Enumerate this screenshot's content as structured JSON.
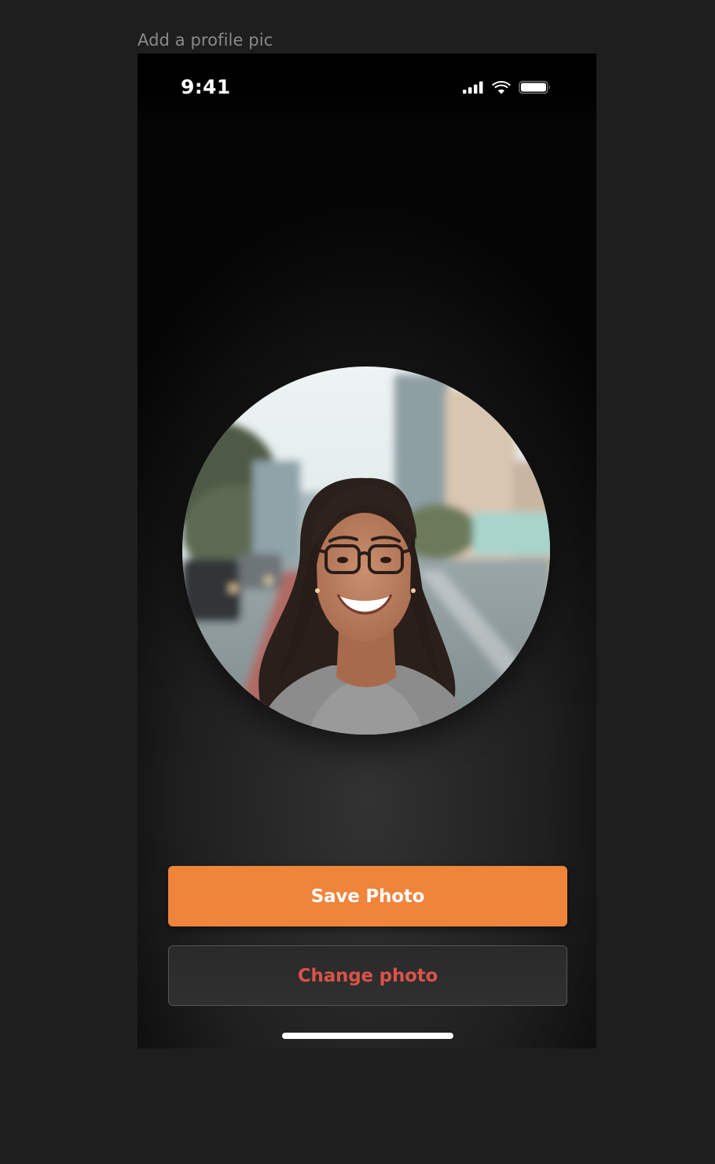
{
  "frame": {
    "label": "Add a profile pic"
  },
  "status_bar": {
    "time": "9:41",
    "icons": [
      "cellular-signal-icon",
      "wifi-icon",
      "battery-icon"
    ]
  },
  "profile": {
    "photo_description": "profile-photo"
  },
  "actions": {
    "save_label": "Save Photo",
    "change_label": "Change photo"
  },
  "colors": {
    "accent": "#ef843b",
    "destructive_text": "#d9534a",
    "canvas": "#1e1e1e",
    "frame_label": "#8a8a8a"
  }
}
